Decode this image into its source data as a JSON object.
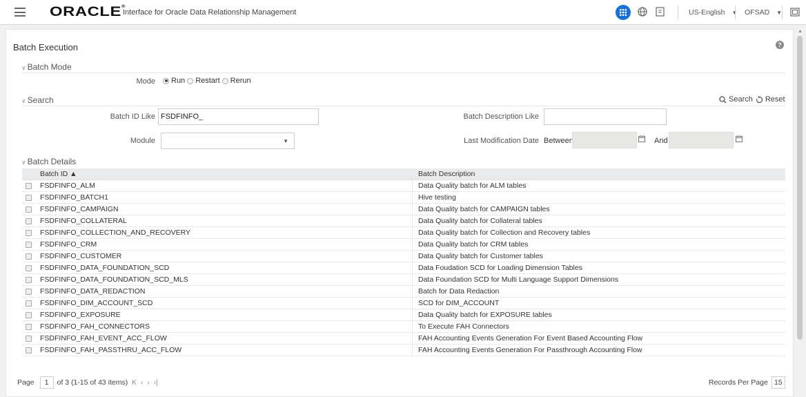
{
  "header": {
    "logo": "ORACLE",
    "logo_mark": "®",
    "app_title": "Interface for Oracle Data Relationship Management",
    "language": "US-English",
    "user": "OFSAD"
  },
  "page": {
    "title": "Batch Execution"
  },
  "batch_mode": {
    "section_label": "Batch Mode",
    "mode_label": "Mode",
    "options": [
      "Run",
      "Restart",
      "Rerun"
    ],
    "selected": "Run"
  },
  "search": {
    "section_label": "Search",
    "search_button": "Search",
    "reset_button": "Reset",
    "batch_id_label": "Batch ID Like",
    "batch_id_value": "FSDFINFO_",
    "batch_desc_label": "Batch Description Like",
    "batch_desc_value": "",
    "module_label": "Module",
    "module_value": "",
    "last_mod_label": "Last Modification Date",
    "between_label": "Between",
    "and_label": "And"
  },
  "batch_details": {
    "section_label": "Batch Details",
    "columns": [
      "Batch ID ▲",
      "Batch Description"
    ],
    "rows": [
      {
        "id": "FSDFINFO_ALM",
        "desc": "Data Quality batch for ALM tables"
      },
      {
        "id": "FSDFINFO_BATCH1",
        "desc": "Hive testing"
      },
      {
        "id": "FSDFINFO_CAMPAIGN",
        "desc": "Data Quality batch for CAMPAIGN tables"
      },
      {
        "id": "FSDFINFO_COLLATERAL",
        "desc": "Data Quality batch for Collateral tables"
      },
      {
        "id": "FSDFINFO_COLLECTION_AND_RECOVERY",
        "desc": "Data Quality batch for Collection and Recovery tables"
      },
      {
        "id": "FSDFINFO_CRM",
        "desc": "Data Quality batch for CRM tables"
      },
      {
        "id": "FSDFINFO_CUSTOMER",
        "desc": "Data Quality batch for Customer tables"
      },
      {
        "id": "FSDFINFO_DATA_FOUNDATION_SCD",
        "desc": "Data Foudation SCD for Loading Dimension Tables"
      },
      {
        "id": "FSDFINFO_DATA_FOUNDATION_SCD_MLS",
        "desc": "Data Foundation SCD for Multi Language Support Dimensions"
      },
      {
        "id": "FSDFINFO_DATA_REDACTION",
        "desc": "Batch for Data Redaction"
      },
      {
        "id": "FSDFINFO_DIM_ACCOUNT_SCD",
        "desc": "SCD for DIM_ACCOUNT"
      },
      {
        "id": "FSDFINFO_EXPOSURE",
        "desc": "Data Quality batch for EXPOSURE tables"
      },
      {
        "id": "FSDFINFO_FAH_CONNECTORS",
        "desc": "To Execute FAH Connectors"
      },
      {
        "id": "FSDFINFO_FAH_EVENT_ACC_FLOW",
        "desc": "FAH Accounting Events Generation For Event Based Accounting Flow"
      },
      {
        "id": "FSDFINFO_FAH_PASSTHRU_ACC_FLOW",
        "desc": "FAH Accounting Events Generation For Passthrough Accounting Flow"
      }
    ]
  },
  "pagination": {
    "page_label": "Page",
    "page_value": "1",
    "page_info": "of 3 (1-15 of 43 items)",
    "records_label": "Records Per Page",
    "records_value": "15"
  },
  "colors": {
    "accent": "#1872d2",
    "header_bg": "#ffffff",
    "page_bg": "#eef0f2",
    "date_bg": "#e7e7e3"
  }
}
